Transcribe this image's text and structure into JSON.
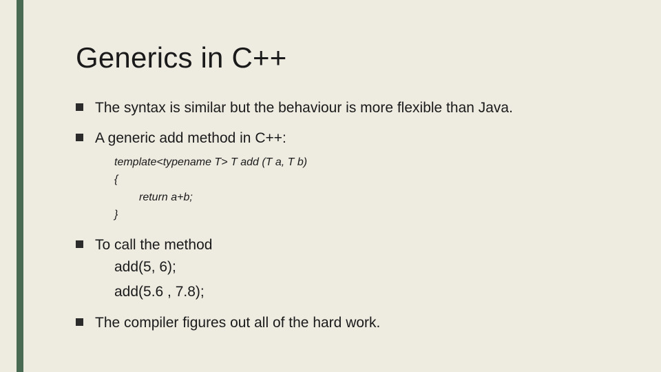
{
  "title": "Generics in C++",
  "bullets": {
    "b1": "The syntax is similar but the behaviour is more flexible than Java.",
    "b2": "A generic add method in C++:",
    "b3": "To call the method",
    "b4": "The compiler figures out all of the hard work."
  },
  "code": {
    "line1": "template<typename T>  T add (T a, T b)",
    "line2": "{",
    "line3": "return a+b;",
    "line4": "}"
  },
  "calls": {
    "c1": "add(5, 6);",
    "c2": "add(5.6 , 7.8);"
  }
}
